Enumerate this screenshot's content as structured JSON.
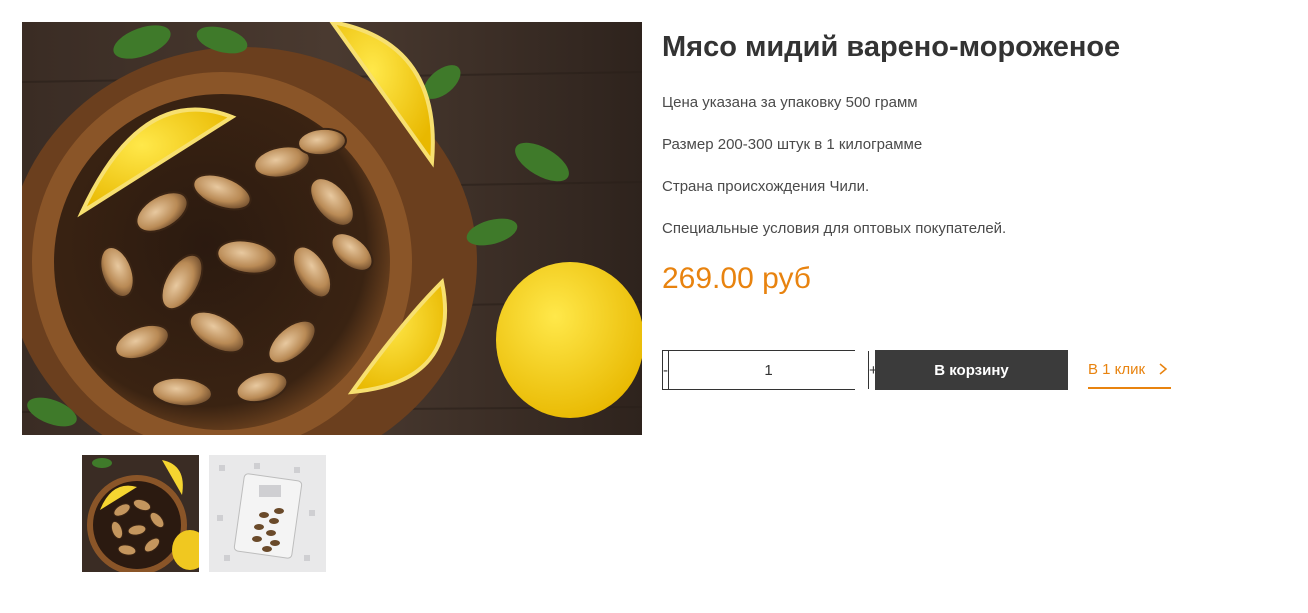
{
  "product": {
    "title": "Мясо мидий варено-мороженое",
    "description": [
      "Цена указана за упаковку 500 грамм",
      "Размер 200-300 штук в 1 килограмме",
      "Страна происхождения Чили.",
      "Специальные условия для оптовых покупателей."
    ],
    "price": "269.00 руб"
  },
  "purchase": {
    "minus_label": "-",
    "plus_label": "+",
    "quantity": "1",
    "add_to_cart_label": "В корзину",
    "one_click_label": "В 1 клик"
  },
  "gallery": {
    "thumbnails": [
      "mussels-bowl-photo",
      "mussels-package-photo"
    ]
  },
  "colors": {
    "accent": "#e8830f",
    "button_dark": "#3b3b3b",
    "title": "#333333"
  }
}
